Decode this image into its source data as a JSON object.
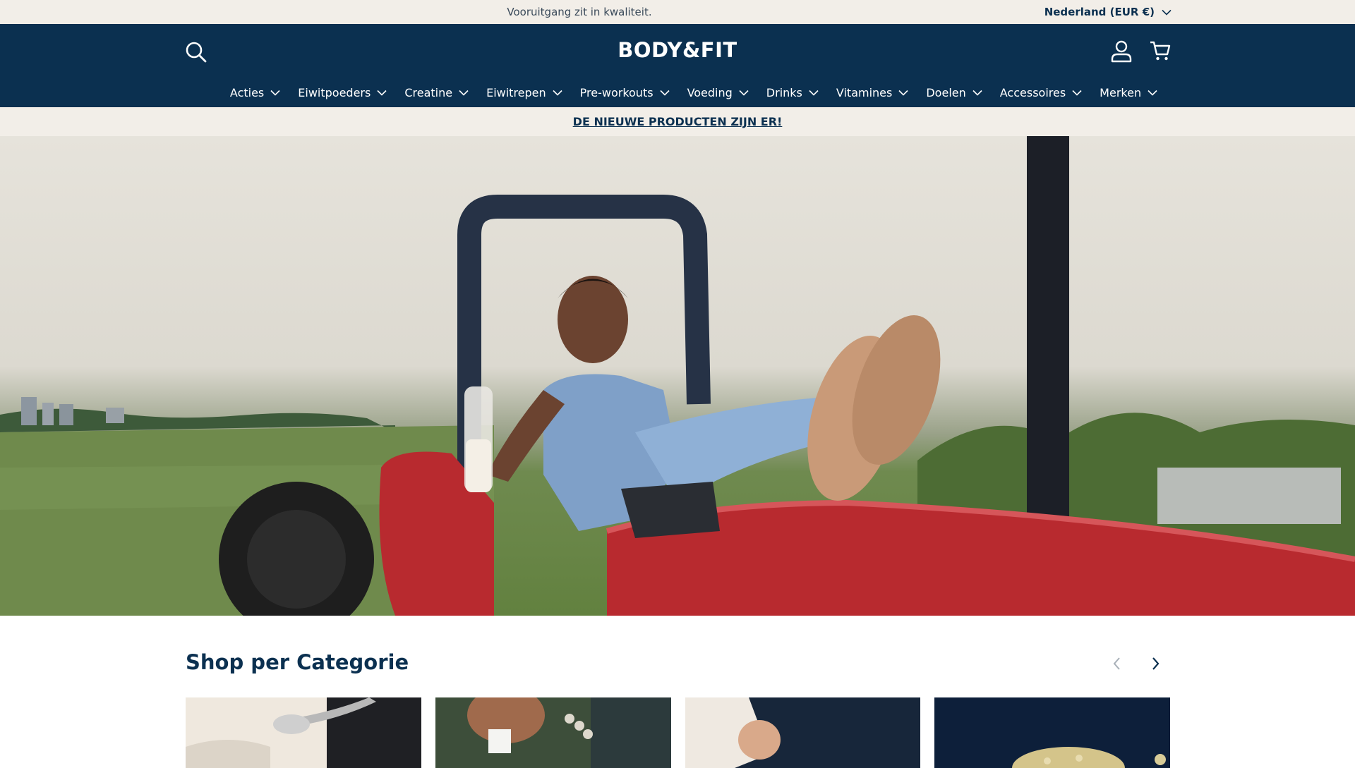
{
  "topbar": {
    "promo_text": "Vooruitgang zit in kwaliteit.",
    "country_label": "Nederland (EUR €)"
  },
  "header": {
    "logo_text": "BODY&FIT",
    "icons": [
      "search-icon",
      "account-icon",
      "cart-icon"
    ],
    "nav": [
      {
        "label": "Acties"
      },
      {
        "label": "Eiwitpoeders"
      },
      {
        "label": "Creatine"
      },
      {
        "label": "Eiwitrepen"
      },
      {
        "label": "Pre-workouts"
      },
      {
        "label": "Voeding"
      },
      {
        "label": "Drinks"
      },
      {
        "label": "Vitamines"
      },
      {
        "label": "Doelen"
      },
      {
        "label": "Accessoires"
      },
      {
        "label": "Merken"
      }
    ]
  },
  "announcement": {
    "link_text": "DE NIEUWE PRODUCTEN ZIJN ER!"
  },
  "categories": {
    "title": "Shop per Categorie",
    "icons": [
      "chevron-left-icon",
      "chevron-right-icon"
    ]
  },
  "colors": {
    "brand_navy": "#0b3050",
    "cream": "#f2eee8",
    "tractor_red": "#b82a2f"
  }
}
